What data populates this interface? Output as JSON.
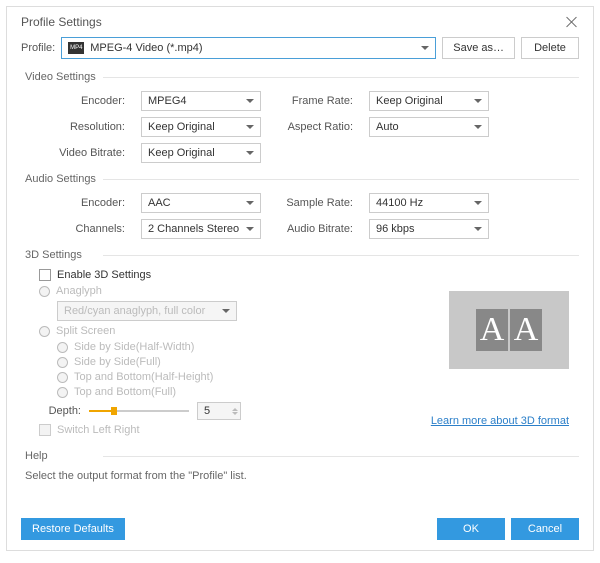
{
  "title": "Profile Settings",
  "profile": {
    "label": "Profile:",
    "value": "MPEG-4 Video (*.mp4)"
  },
  "saveAs": "Save as…",
  "delete": "Delete",
  "video": {
    "title": "Video Settings",
    "encoder": {
      "label": "Encoder:",
      "value": "MPEG4"
    },
    "resolution": {
      "label": "Resolution:",
      "value": "Keep Original"
    },
    "bitrate": {
      "label": "Video Bitrate:",
      "value": "Keep Original"
    },
    "frameRate": {
      "label": "Frame Rate:",
      "value": "Keep Original"
    },
    "aspectRatio": {
      "label": "Aspect Ratio:",
      "value": "Auto"
    }
  },
  "audio": {
    "title": "Audio Settings",
    "encoder": {
      "label": "Encoder:",
      "value": "AAC"
    },
    "channels": {
      "label": "Channels:",
      "value": "2 Channels Stereo"
    },
    "sampleRate": {
      "label": "Sample Rate:",
      "value": "44100 Hz"
    },
    "bitrate": {
      "label": "Audio Bitrate:",
      "value": "96 kbps"
    }
  },
  "threed": {
    "title": "3D Settings",
    "enable": "Enable 3D Settings",
    "anaglyph": "Anaglyph",
    "anaglyphValue": "Red/cyan anaglyph, full color",
    "splitScreen": "Split Screen",
    "options": [
      "Side by Side(Half-Width)",
      "Side by Side(Full)",
      "Top and Bottom(Half-Height)",
      "Top and Bottom(Full)"
    ],
    "depth": {
      "label": "Depth:",
      "value": "5"
    },
    "switchLR": "Switch Left Right",
    "link": "Learn more about 3D format"
  },
  "help": {
    "title": "Help",
    "text": "Select the output format from the \"Profile\" list."
  },
  "footer": {
    "restore": "Restore Defaults",
    "ok": "OK",
    "cancel": "Cancel"
  }
}
